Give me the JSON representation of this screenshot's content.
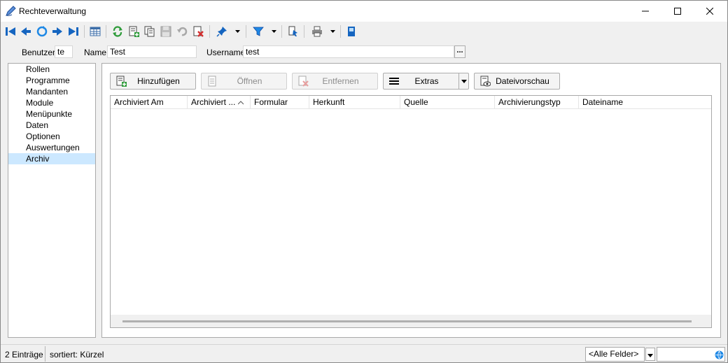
{
  "window": {
    "title": "Rechteverwaltung",
    "minimize_icon": "minimize-icon",
    "maximize_icon": "maximize-icon",
    "close_icon": "close-icon"
  },
  "toolbar": {
    "icons": [
      "first-record-icon",
      "previous-record-icon",
      "refresh-icon",
      "next-record-icon",
      "last-record-icon",
      "table-view-icon",
      "reload-icon",
      "new-record-icon",
      "copy-record-icon",
      "save-icon",
      "undo-icon",
      "delete-icon",
      "pin-icon",
      "filter-icon",
      "bookmark-icon",
      "print-icon",
      "module-icon"
    ],
    "accent_color": "#1565c0"
  },
  "user": {
    "benutzer_label": "Benutzer",
    "benutzer_value": "te",
    "name_label": "Name",
    "name_value": "Test",
    "username_label": "Username",
    "username_value": "test",
    "browse_label": "..."
  },
  "sidebar": {
    "items": [
      {
        "label": "Rollen"
      },
      {
        "label": "Programme"
      },
      {
        "label": "Mandanten"
      },
      {
        "label": "Module"
      },
      {
        "label": "Menüpunkte"
      },
      {
        "label": "Daten"
      },
      {
        "label": "Optionen"
      },
      {
        "label": "Auswertungen"
      },
      {
        "label": "Archiv",
        "selected": true
      }
    ],
    "selected_color": "#cce8ff"
  },
  "archive": {
    "buttons": {
      "add": "Hinzufügen",
      "open": "Öffnen",
      "remove": "Entfernen",
      "extras": "Extras",
      "preview": "Dateivorschau"
    },
    "columns": [
      "Archiviert Am",
      "Archiviert ...",
      "Formular",
      "Herkunft",
      "Quelle",
      "Archivierungstyp",
      "Dateiname"
    ],
    "sorted_column_icon": "sort-ascending-icon",
    "rows": []
  },
  "status": {
    "count": "2 Einträge",
    "sort": "sortiert: Kürzel",
    "field_filter": "<Alle Felder>",
    "search_value": ""
  }
}
